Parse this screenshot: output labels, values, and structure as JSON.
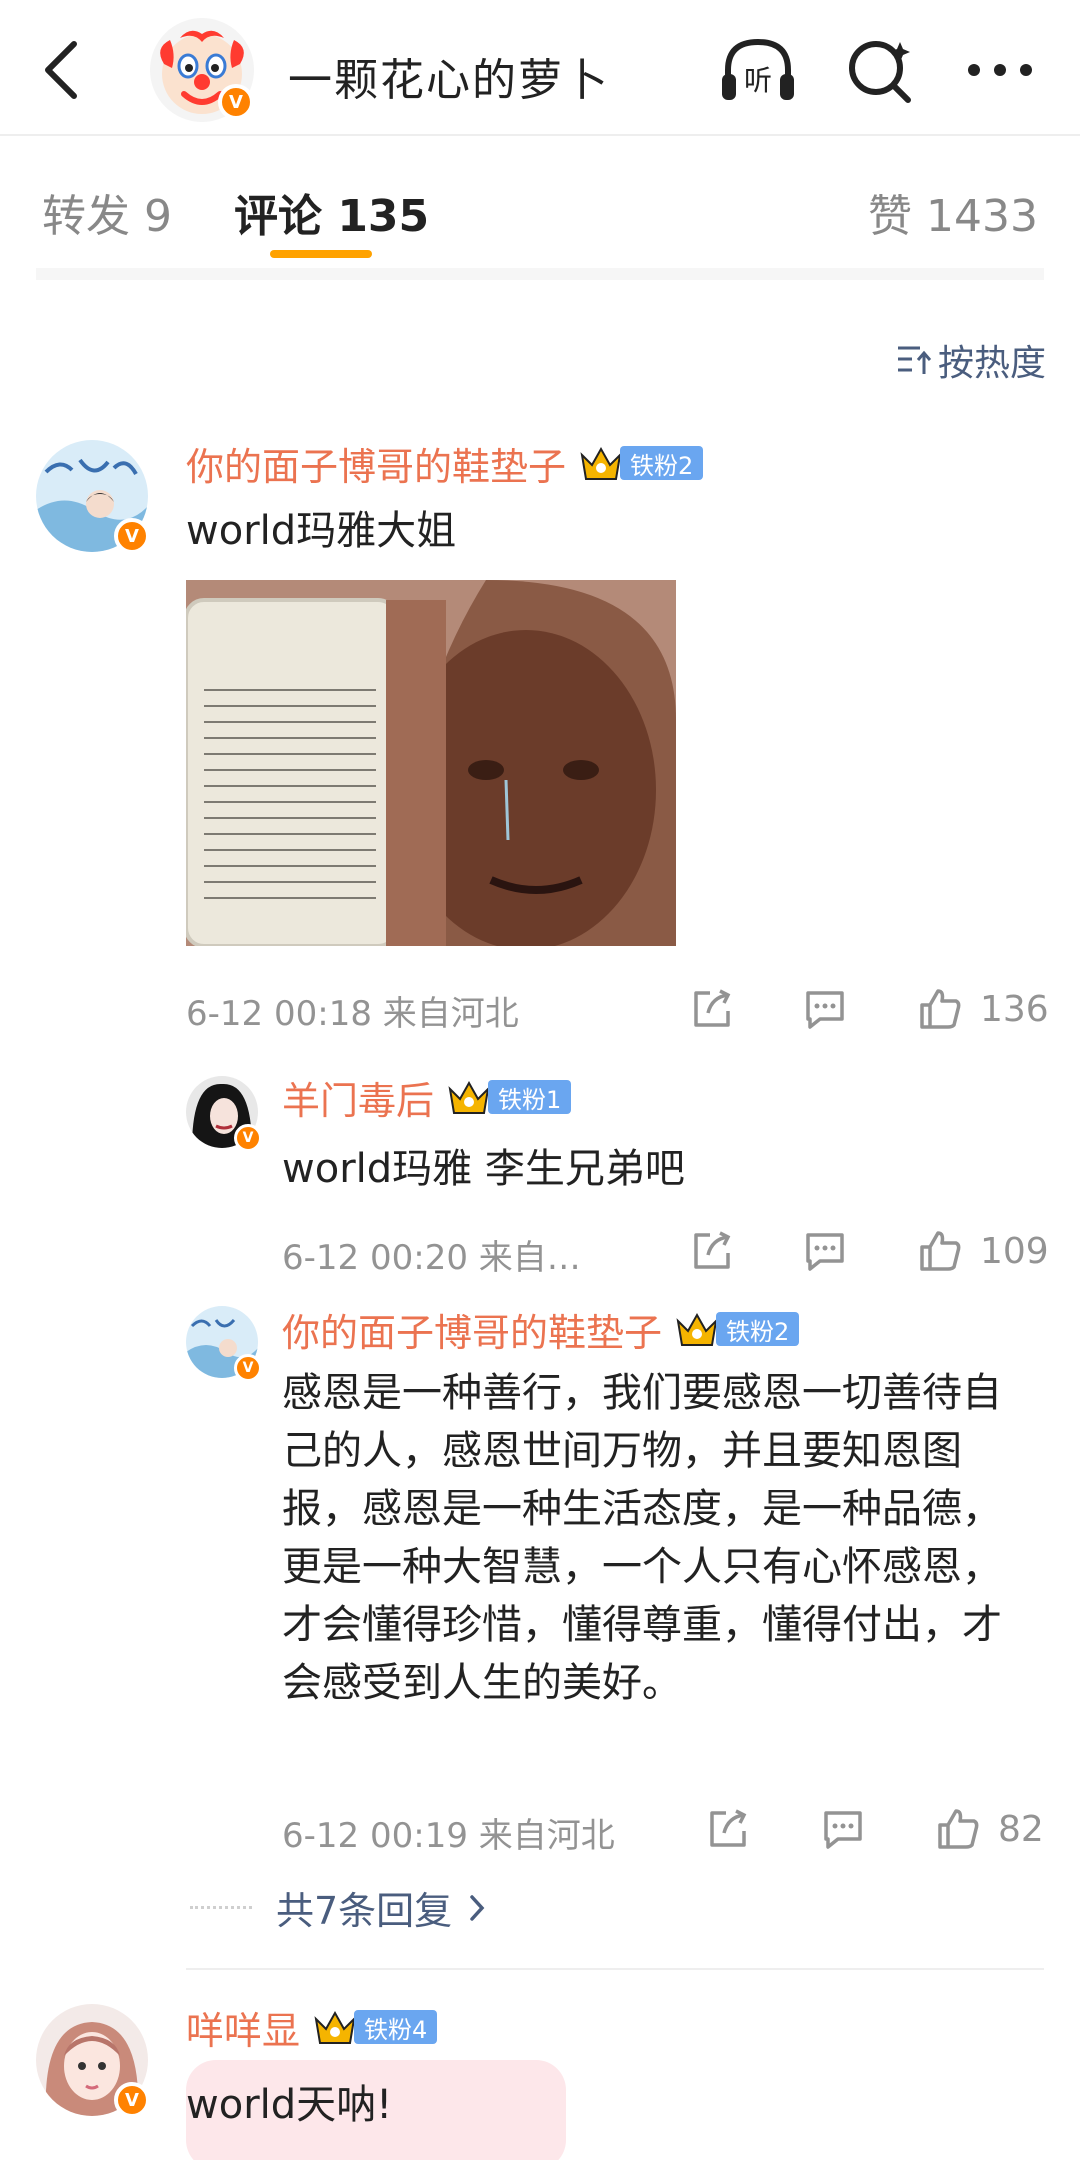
{
  "header": {
    "title": "一颗花心的萝卜",
    "avatar_icon": "clown-face-icon"
  },
  "tabs": {
    "repost": "转发 9",
    "comment": "评论 135",
    "like": "赞 1433"
  },
  "sort": {
    "label": "按热度"
  },
  "comments": [
    {
      "username": "你的面子博哥的鞋垫子",
      "fan_badge": "铁粉2",
      "text": "world玛雅大姐",
      "time": "6-12 00:18",
      "location": "来自河北",
      "likes": "136"
    },
    {
      "username": "咩咩显",
      "fan_badge": "铁粉4",
      "text": "world天呐!"
    }
  ],
  "replies": [
    {
      "username": "羊门毒后",
      "fan_badge": "铁粉1",
      "text": "world玛雅 李生兄弟吧",
      "time": "6-12 00:20",
      "location": "来自…",
      "likes": "109"
    },
    {
      "username": "你的面子博哥的鞋垫子",
      "fan_badge": "铁粉2",
      "text": "感恩是一种善行，我们要感恩一切善待自己的人，感恩世间万物，并且要知恩图报，感恩是一种生活态度，是一种品德，更是一种大智慧，一个人只有心怀感恩，才会懂得珍惜，懂得尊重，懂得付出，才会感受到人生的美好。",
      "time": "6-12 00:19",
      "location": "来自河北",
      "likes": "82"
    }
  ],
  "more_replies": "共7条回复",
  "colors": {
    "username": "#eb7350",
    "accent": "#ffa200",
    "link": "#4a5d7e",
    "fan_badge": "#6aa6f0",
    "verified": "#ff8200"
  }
}
